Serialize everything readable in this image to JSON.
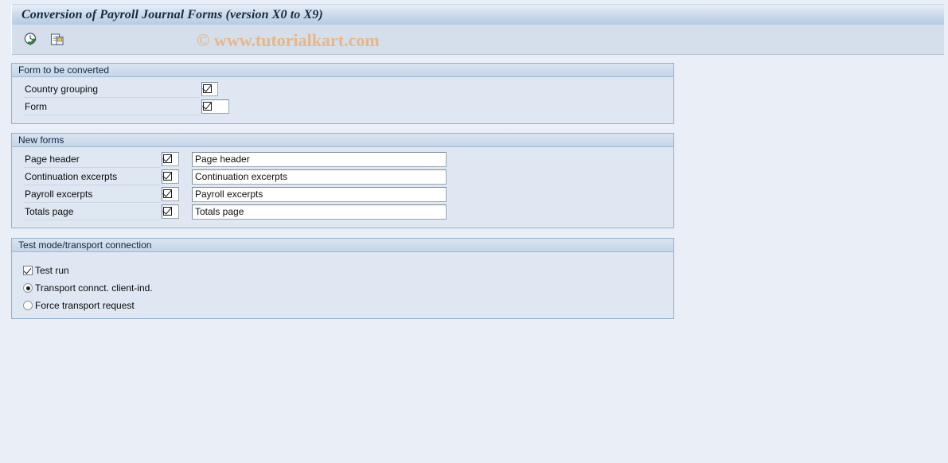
{
  "window": {
    "title": "Conversion of Payroll Journal Forms (version X0 to X9)"
  },
  "toolbar": {
    "buttons": [
      {
        "name": "execute-icon",
        "tooltip": "Execute"
      },
      {
        "name": "copy-icon",
        "tooltip": "Copy"
      }
    ]
  },
  "watermark": {
    "text": "© www.tutorialkart.com",
    "color": "#e7b787"
  },
  "groups": {
    "form_to_be_converted": {
      "title": "Form to be converted",
      "rows": [
        {
          "label": "Country grouping",
          "value": "",
          "icon": "checkbox-glyph-icon"
        },
        {
          "label": "Form",
          "value": "",
          "icon": "checkbox-glyph-icon"
        }
      ]
    },
    "new_forms": {
      "title": "New forms",
      "rows": [
        {
          "label": "Page header",
          "key_value": "",
          "text_value": "Page header",
          "icon": "checkbox-glyph-icon"
        },
        {
          "label": "Continuation excerpts",
          "key_value": "",
          "text_value": "Continuation excerpts",
          "icon": "checkbox-glyph-icon"
        },
        {
          "label": "Payroll excerpts",
          "key_value": "",
          "text_value": "Payroll excerpts",
          "icon": "checkbox-glyph-icon"
        },
        {
          "label": "Totals page",
          "key_value": "",
          "text_value": "Totals page",
          "icon": "checkbox-glyph-icon"
        }
      ]
    },
    "test_mode": {
      "title": "Test mode/transport connection",
      "checkbox": {
        "label": "Test run",
        "checked": true
      },
      "radios": [
        {
          "label": "Transport connct. client-ind.",
          "selected": true
        },
        {
          "label": "Force transport request",
          "selected": false
        }
      ]
    }
  }
}
